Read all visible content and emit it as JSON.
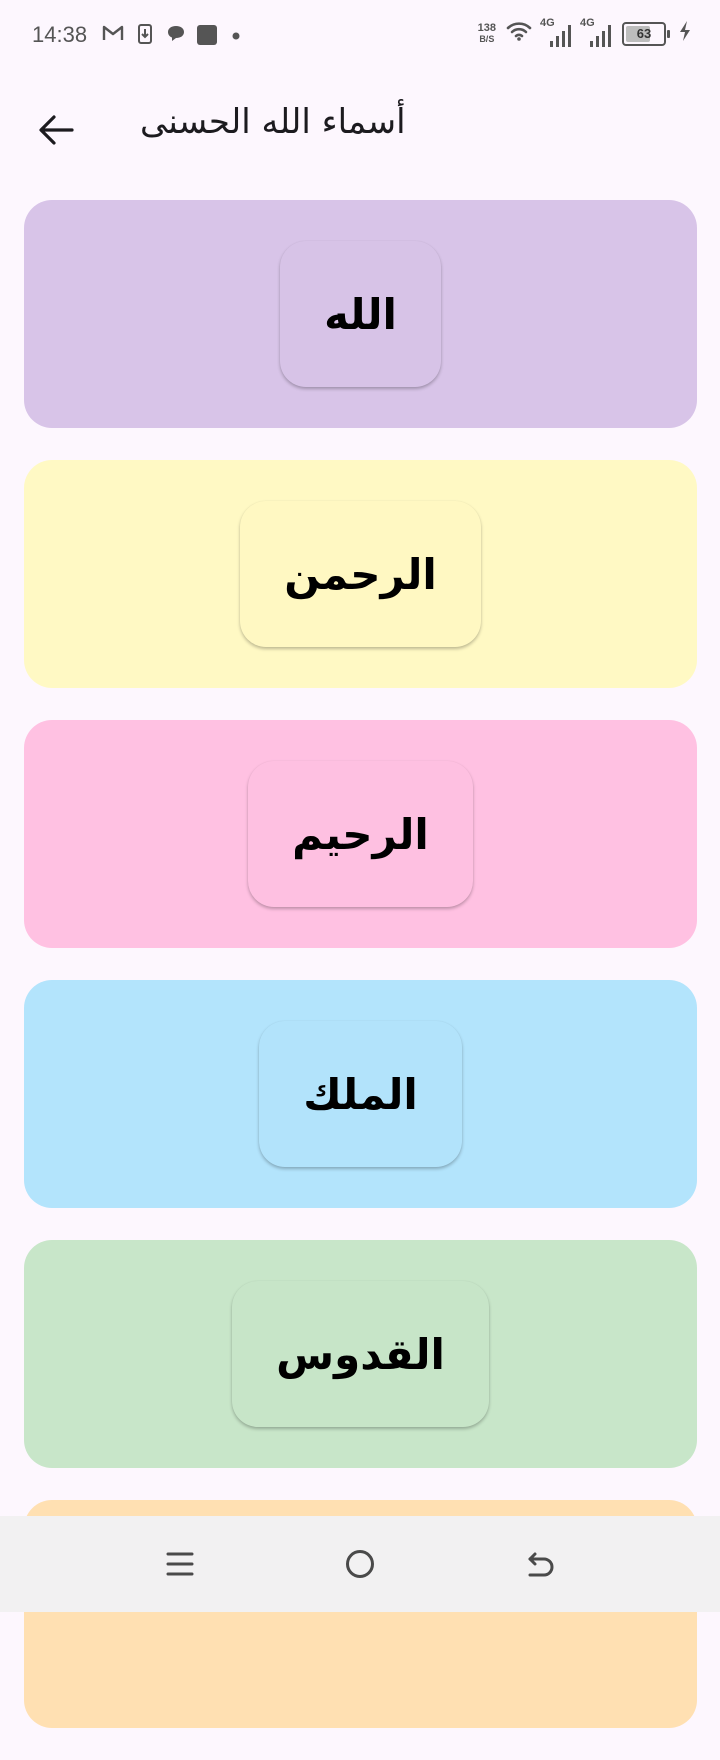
{
  "status_bar": {
    "time": "14:38",
    "net_speed_value": "138",
    "net_speed_unit": "B/S",
    "signal1_label": "4G",
    "signal2_label": "4G",
    "battery_level": "63",
    "icons": [
      "gmail-icon",
      "download-icon",
      "chat-icon",
      "app-square-icon",
      "dot-icon",
      "wifi-icon",
      "signal-icon",
      "battery-icon",
      "charging-icon"
    ]
  },
  "app_bar": {
    "title": "أسماء الله الحسنى",
    "back_icon": "arrow-back-icon"
  },
  "names": [
    {
      "label": "الله",
      "card_color": "#D8C4E8",
      "chip_color": "#D7C3E7"
    },
    {
      "label": "الرحمن",
      "card_color": "#FFF9C4",
      "chip_color": "#FFF8C2"
    },
    {
      "label": "الرحيم",
      "card_color": "#FFC1E2",
      "chip_color": "#FEC0E1"
    },
    {
      "label": "الملك",
      "card_color": "#B3E4FC",
      "chip_color": "#B2E3FB"
    },
    {
      "label": "القدوس",
      "card_color": "#C8E6C9",
      "chip_color": "#C7E5C8"
    },
    {
      "label": "",
      "card_color": "#FFE0B2",
      "chip_color": "#FFE0B2"
    }
  ],
  "nav_bar": {
    "icons": [
      "menu-icon",
      "home-circle-icon",
      "back-icon"
    ]
  }
}
